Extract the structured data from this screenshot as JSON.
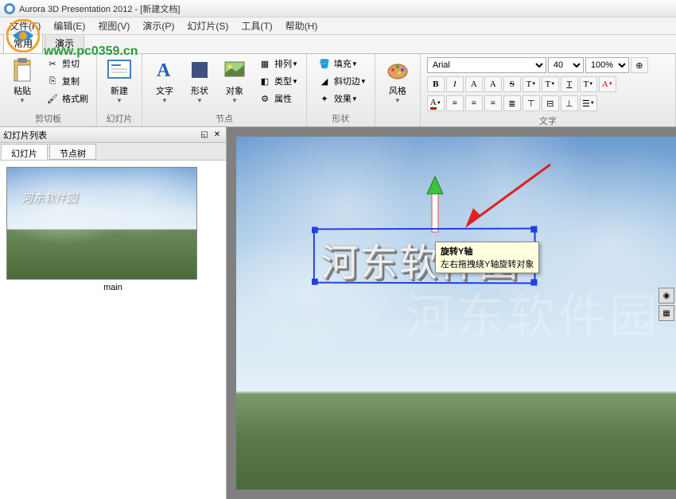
{
  "titlebar": {
    "app_name": "Aurora 3D Presentation 2012",
    "document": "[新建文档]"
  },
  "menubar": {
    "items": [
      {
        "label": "文件(F)"
      },
      {
        "label": "编辑(E)"
      },
      {
        "label": "视图(V)"
      },
      {
        "label": "演示(P)"
      },
      {
        "label": "幻灯片(S)"
      },
      {
        "label": "工具(T)"
      },
      {
        "label": "帮助(H)"
      }
    ]
  },
  "watermark_url": "www.pc0359.cn",
  "ribbon_tabs": {
    "items": [
      {
        "label": "常用",
        "active": true
      },
      {
        "label": "演示",
        "active": false
      }
    ]
  },
  "ribbon": {
    "clipboard": {
      "paste": "粘贴",
      "cut": "剪切",
      "copy": "复制",
      "format_painter": "格式刷",
      "group_label": "剪切板"
    },
    "slide": {
      "new": "新建",
      "group_label": "幻灯片"
    },
    "node": {
      "text": "文字",
      "shape": "形状",
      "object": "对象",
      "arrange": "排列",
      "type": "类型",
      "attribute": "属性",
      "group_label": "节点"
    },
    "shape_group": {
      "fill": "填充",
      "bevel": "斜切边",
      "effect": "效果",
      "group_label": "形状"
    },
    "style": {
      "label": "风格"
    },
    "font": {
      "family": "Arial",
      "size": "40",
      "zoom": "100%",
      "group_label": "文字"
    }
  },
  "side_panel": {
    "title": "幻灯片列表",
    "tabs": [
      {
        "label": "幻灯片",
        "active": true
      },
      {
        "label": "节点树",
        "active": false
      }
    ],
    "slides": [
      {
        "name": "main",
        "thumb_text": "河东软件园"
      }
    ]
  },
  "canvas": {
    "text_3d": "河东软件园",
    "tooltip": {
      "title": "旋转Y轴",
      "desc": "左右拖拽绕Y轴旋转对象"
    },
    "watermark": "河东软件园"
  }
}
